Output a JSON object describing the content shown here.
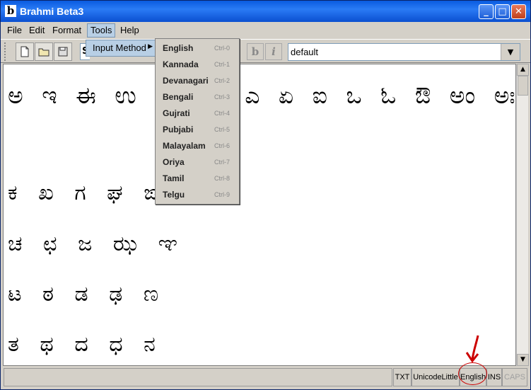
{
  "window": {
    "title": "Brahmi Beta3",
    "icon_letter": "b",
    "minimize": "_",
    "maximize": "□",
    "close": "✕"
  },
  "menubar": {
    "items": [
      "File",
      "Edit",
      "Format",
      "Tools",
      "Help"
    ],
    "active": "Tools"
  },
  "toolbar": {
    "icons": [
      "new-file-icon",
      "open-folder-icon",
      "save-disk-icon"
    ],
    "font_field_prefix": "S",
    "bold_label": "b",
    "italic_label": "i",
    "style_combo_value": "default",
    "combo_arrow": "▼"
  },
  "tools_menu": {
    "input_method_label": "Input Method",
    "caret": "▶"
  },
  "input_methods": [
    {
      "label": "English",
      "shortcut": "Ctrl-0"
    },
    {
      "label": "Kannada",
      "shortcut": "Ctrl-1"
    },
    {
      "label": "Devanagari",
      "shortcut": "Ctrl-2"
    },
    {
      "label": "Bengali",
      "shortcut": "Ctrl-3"
    },
    {
      "label": "Gujrati",
      "shortcut": "Ctrl-4"
    },
    {
      "label": "Pubjabi",
      "shortcut": "Ctrl-5"
    },
    {
      "label": "Malayalam",
      "shortcut": "Ctrl-6"
    },
    {
      "label": "Oriya",
      "shortcut": "Ctrl-7"
    },
    {
      "label": "Tamil",
      "shortcut": "Ctrl-8"
    },
    {
      "label": "Telgu",
      "shortcut": "Ctrl-9"
    }
  ],
  "editor": {
    "lines": [
      "ಅ ಇ ಈ ಉ ಊ ಋ ಎ ಏ ಐ ಒ ಓ ಔ ಅಂ ಅಃ",
      "ಕ ಖ ಗ ಘ ಙ",
      "ಚ ಛ ಜ ಝ ಞ",
      "ಟ ಠ ಡ ಢ ಣ",
      "ತ ಥ ದ ಧ ನ"
    ]
  },
  "statusbar": {
    "format": "TXT",
    "encoding": "UnicodeLittle",
    "input_method": "English",
    "insert_mode": "INS",
    "caps": "CAPS"
  },
  "colors": {
    "titlebar": "#0a5be0",
    "menu_highlight": "#b8cfe5",
    "annotation": "#cc0000"
  }
}
